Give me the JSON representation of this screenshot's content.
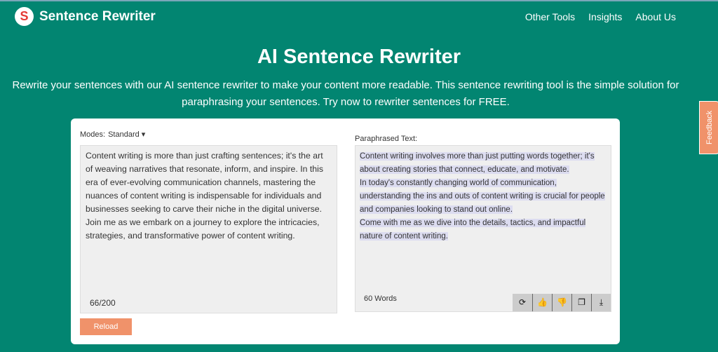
{
  "header": {
    "brand": "Sentence Rewriter",
    "logo_letter": "S",
    "nav": [
      "Other Tools",
      "Insights",
      "About Us"
    ]
  },
  "hero": {
    "title": "AI Sentence Rewriter",
    "subtitle_line1": "Rewrite your sentences with our AI sentence rewriter to make your content more readable. This sentence rewriting tool is the simple solution for",
    "subtitle_line2": "paraphrasing your sentences. Try now to rewriter sentences for FREE."
  },
  "input": {
    "modes_label": "Modes:",
    "mode": "Standard",
    "text": "Content writing is more than just crafting sentences; it's the art of weaving narratives that resonate, inform, and inspire. In this era of ever-evolving communication channels, mastering the nuances of content writing is indispensable for individuals and businesses seeking to carve their niche in the digital universe. Join me as we embark on a journey to explore the intricacies, strategies, and transformative power of content writing.",
    "count": "66/200",
    "reload_label": "Reload"
  },
  "output": {
    "label": "Paraphrased Text:",
    "paragraphs": [
      "Content writing involves more than just putting words together; it's about creating stories that connect, educate, and motivate.",
      "In today's constantly changing world of communication, understanding the ins and outs of content writing is crucial for people and companies looking to stand out online.",
      "Come with me as we dive into the details, tactics, and impactful nature of content writing."
    ],
    "word_count": "60 Words",
    "tools": [
      "refresh-icon",
      "thumbs-up-icon",
      "thumbs-down-icon",
      "copy-icon",
      "download-icon"
    ]
  },
  "feedback_label": "Feedback",
  "colors": {
    "primary": "#028571",
    "accent": "#f0926a"
  }
}
